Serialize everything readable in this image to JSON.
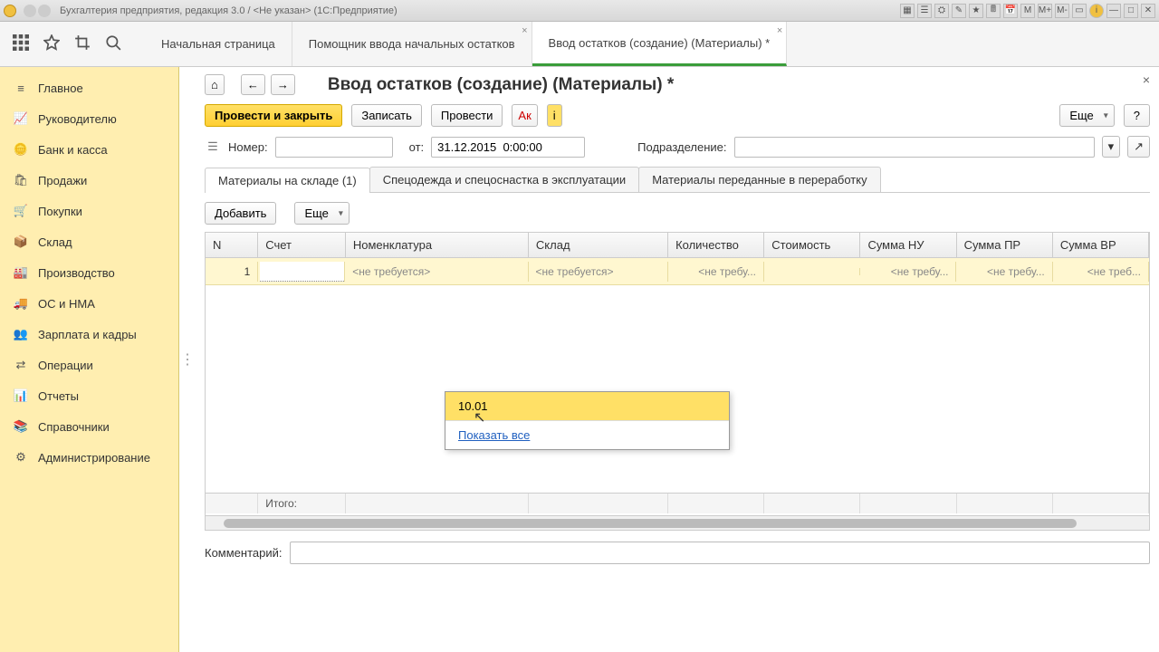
{
  "titlebar": {
    "title": "Бухгалтерия предприятия, редакция 3.0 / <Не указан> (1С:Предприятие)"
  },
  "tabs": [
    {
      "label": "Начальная страница",
      "closable": false
    },
    {
      "label": "Помощник ввода начальных остатков",
      "closable": true
    },
    {
      "label": "Ввод остатков (создание) (Материалы) *",
      "closable": true
    }
  ],
  "sidebar": [
    {
      "label": "Главное",
      "icon": "menu"
    },
    {
      "label": "Руководителю",
      "icon": "chart"
    },
    {
      "label": "Банк и касса",
      "icon": "coin"
    },
    {
      "label": "Продажи",
      "icon": "bag"
    },
    {
      "label": "Покупки",
      "icon": "cart"
    },
    {
      "label": "Склад",
      "icon": "box"
    },
    {
      "label": "Производство",
      "icon": "factory"
    },
    {
      "label": "ОС и НМА",
      "icon": "truck"
    },
    {
      "label": "Зарплата и кадры",
      "icon": "people"
    },
    {
      "label": "Операции",
      "icon": "ops"
    },
    {
      "label": "Отчеты",
      "icon": "bars"
    },
    {
      "label": "Справочники",
      "icon": "book"
    },
    {
      "label": "Администрирование",
      "icon": "gear"
    }
  ],
  "doc": {
    "title": "Ввод остатков (создание) (Материалы) *",
    "cmd_post_close": "Провести и закрыть",
    "cmd_write": "Записать",
    "cmd_post": "Провести",
    "cmd_more": "Еще",
    "cmd_help": "?",
    "number_label": "Номер:",
    "number_value": "",
    "date_label": "от:",
    "date_value": "31.12.2015  0:00:00",
    "department_label": "Подразделение:",
    "department_value": ""
  },
  "innertabs": [
    "Материалы на складе (1)",
    "Спецодежда и спецоснастка в эксплуатации",
    "Материалы переданные в переработку"
  ],
  "grid": {
    "add": "Добавить",
    "more": "Еще",
    "headers": [
      "N",
      "Счет",
      "Номенклатура",
      "Склад",
      "Количество",
      "Стоимость",
      "Сумма НУ",
      "Сумма ПР",
      "Сумма ВР"
    ],
    "row": {
      "n": "1",
      "account": "",
      "nomen": "<не требуется>",
      "sklad": "<не требуется>",
      "qty": "<не требу...",
      "cost": "",
      "nu": "<не требу...",
      "pr": "<не требу...",
      "vr": "<не треб..."
    },
    "footer_label": "Итого:"
  },
  "popup": {
    "option": "10.01",
    "show_all": "Показать все"
  },
  "comment": {
    "label": "Комментарий:",
    "value": ""
  }
}
